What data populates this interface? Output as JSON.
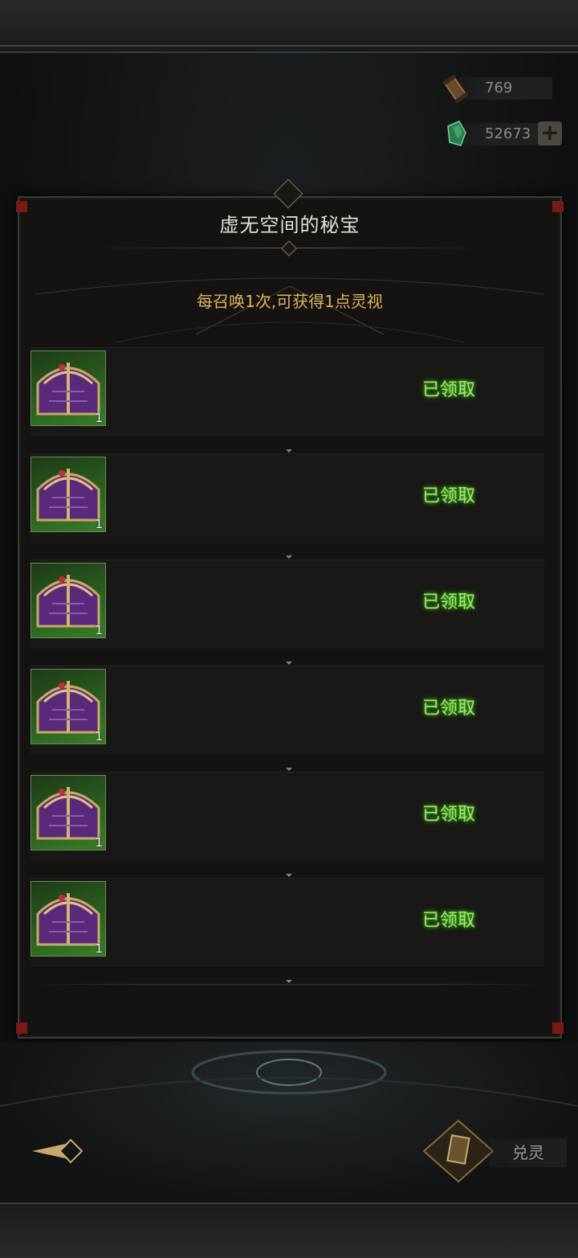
{
  "currencies": [
    {
      "icon": "scroll-icon",
      "value": "769"
    },
    {
      "icon": "green-crystal-icon",
      "value": "52673"
    }
  ],
  "panel": {
    "title": "虚无空间的秘宝",
    "subtitle": "每召唤1次,可获得1点灵视"
  },
  "rewards": [
    {
      "icon": "purple-treasure-chest-icon",
      "quantity": "1",
      "status": "已领取"
    },
    {
      "icon": "purple-treasure-chest-icon",
      "quantity": "1",
      "status": "已领取"
    },
    {
      "icon": "purple-treasure-chest-icon",
      "quantity": "1",
      "status": "已领取"
    },
    {
      "icon": "purple-treasure-chest-icon",
      "quantity": "1",
      "status": "已领取"
    },
    {
      "icon": "purple-treasure-chest-icon",
      "quantity": "1",
      "status": "已领取"
    },
    {
      "icon": "purple-treasure-chest-icon",
      "quantity": "1",
      "status": "已领取"
    }
  ],
  "bottom": {
    "summon_label": "兑灵"
  },
  "colors": {
    "claimed_text": "#a6e26a",
    "subtitle_text": "#e0b35a",
    "panel_bg": "#141312"
  }
}
